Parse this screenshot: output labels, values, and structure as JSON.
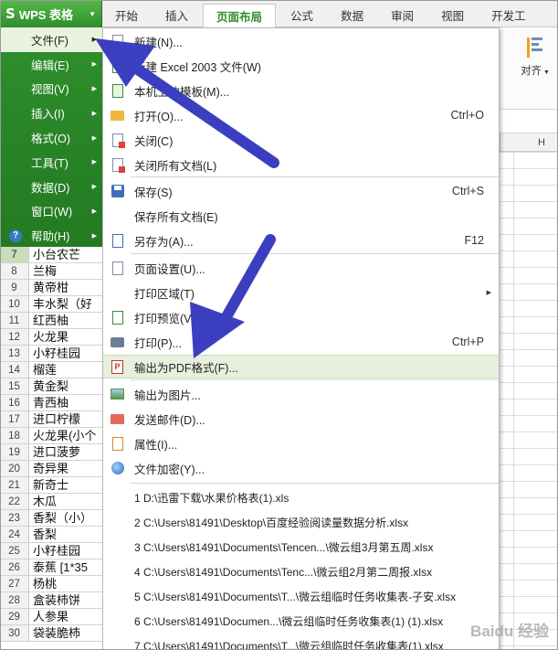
{
  "app": {
    "title": "WPS 表格"
  },
  "ribbon": {
    "tabs": [
      {
        "label": "开始",
        "active": false
      },
      {
        "label": "插入",
        "active": false
      },
      {
        "label": "页面布局",
        "active": true
      },
      {
        "label": "公式",
        "active": false
      },
      {
        "label": "数据",
        "active": false
      },
      {
        "label": "审阅",
        "active": false
      },
      {
        "label": "视图",
        "active": false
      },
      {
        "label": "开发工",
        "active": false
      }
    ],
    "align_label": "对齐"
  },
  "main_menu": [
    {
      "label": "文件(F)",
      "active": true,
      "icon": ""
    },
    {
      "label": "编辑(E)",
      "active": false,
      "icon": ""
    },
    {
      "label": "视图(V)",
      "active": false,
      "icon": ""
    },
    {
      "label": "插入(I)",
      "active": false,
      "icon": ""
    },
    {
      "label": "格式(O)",
      "active": false,
      "icon": ""
    },
    {
      "label": "工具(T)",
      "active": false,
      "icon": ""
    },
    {
      "label": "数据(D)",
      "active": false,
      "icon": ""
    },
    {
      "label": "窗口(W)",
      "active": false,
      "icon": ""
    },
    {
      "label": "帮助(H)",
      "active": false,
      "icon": "help-icon"
    }
  ],
  "file_menu": {
    "items": [
      {
        "label": "新建(N)...",
        "shortcut": "",
        "icon": "new-file-icon"
      },
      {
        "label": "新建 Excel 2003 文件(W)",
        "shortcut": "",
        "icon": "new-excel-icon"
      },
      {
        "label": "本机上的模板(M)...",
        "shortcut": "",
        "icon": "template-icon"
      },
      {
        "label": "打开(O)...",
        "shortcut": "Ctrl+O",
        "icon": "open-folder-icon"
      },
      {
        "label": "关闭(C)",
        "shortcut": "",
        "icon": "close-doc-icon"
      },
      {
        "label": "关闭所有文档(L)",
        "shortcut": "",
        "icon": "close-all-icon"
      },
      {
        "label": "保存(S)",
        "shortcut": "Ctrl+S",
        "icon": "save-icon"
      },
      {
        "label": "保存所有文档(E)",
        "shortcut": "",
        "icon": ""
      },
      {
        "label": "另存为(A)...",
        "shortcut": "F12",
        "icon": "save-as-icon"
      },
      {
        "label": "页面设置(U)...",
        "shortcut": "",
        "icon": "page-setup-icon"
      },
      {
        "label": "打印区域(T)",
        "shortcut": "",
        "icon": "",
        "submenu": true
      },
      {
        "label": "打印预览(V)",
        "shortcut": "",
        "icon": "print-preview-icon"
      },
      {
        "label": "打印(P)...",
        "shortcut": "Ctrl+P",
        "icon": "printer-icon"
      },
      {
        "label": "输出为PDF格式(F)...",
        "shortcut": "",
        "icon": "pdf-icon",
        "highlighted": true
      },
      {
        "label": "输出为图片...",
        "shortcut": "",
        "icon": "image-icon"
      },
      {
        "label": "发送邮件(D)...",
        "shortcut": "",
        "icon": "mail-icon"
      },
      {
        "label": "属性(I)...",
        "shortcut": "",
        "icon": "properties-icon"
      },
      {
        "label": "文件加密(Y)...",
        "shortcut": "",
        "icon": "encrypt-icon"
      }
    ],
    "recent_files": [
      "1 D:\\迅雷下载\\水果价格表(1).xls",
      "2 C:\\Users\\81491\\Desktop\\百度经验阅读量数据分析.xlsx",
      "3 C:\\Users\\81491\\Documents\\Tencen...\\微云组3月第五周.xlsx",
      "4 C:\\Users\\81491\\Documents\\Tenc...\\微云组2月第二周报.xlsx",
      "5 C:\\Users\\81491\\Documents\\T...\\微云组临时任务收集表-子安.xlsx",
      "6 C:\\Users\\81491\\Documen...\\微云组临时任务收集表(1) (1).xlsx",
      "7 C:\\Users\\81491\\Documents\\T...\\微云组临时任务收集表(1).xlsx"
    ]
  },
  "sheet": {
    "column_label": "H",
    "rows": [
      {
        "num": "7",
        "value": "小台农芒",
        "selected": true
      },
      {
        "num": "8",
        "value": "兰梅"
      },
      {
        "num": "9",
        "value": "黄帝柑"
      },
      {
        "num": "10",
        "value": "丰水梨（好"
      },
      {
        "num": "11",
        "value": "红西柚"
      },
      {
        "num": "12",
        "value": "火龙果"
      },
      {
        "num": "13",
        "value": "小籽桂园"
      },
      {
        "num": "14",
        "value": "榴莲"
      },
      {
        "num": "15",
        "value": "黄金梨"
      },
      {
        "num": "16",
        "value": "青西柚"
      },
      {
        "num": "17",
        "value": "进口柠檬"
      },
      {
        "num": "18",
        "value": "火龙果(小个"
      },
      {
        "num": "19",
        "value": "进口菠萝"
      },
      {
        "num": "20",
        "value": "奇异果"
      },
      {
        "num": "21",
        "value": "新奇士"
      },
      {
        "num": "22",
        "value": "木瓜"
      },
      {
        "num": "23",
        "value": "香梨（小）"
      },
      {
        "num": "24",
        "value": "香梨"
      },
      {
        "num": "25",
        "value": "小籽桂园"
      },
      {
        "num": "26",
        "value": "泰蕉 [1*35"
      },
      {
        "num": "27",
        "value": "杨桃"
      },
      {
        "num": "28",
        "value": "盒装柿饼"
      },
      {
        "num": "29",
        "value": "人参果"
      },
      {
        "num": "30",
        "value": "袋装脆柿"
      }
    ]
  },
  "watermark": "Baidu 经验",
  "colors": {
    "wps_green": "#2e8f2c",
    "highlight": "#e6f0dc",
    "arrow": "#3b3fbf"
  }
}
